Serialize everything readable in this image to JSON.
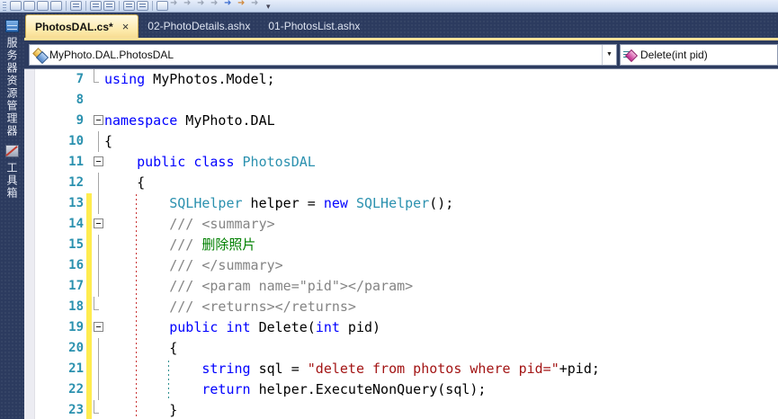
{
  "colors": {
    "tab_active": "#fde9a9",
    "chrome_navy": "#2c3b5f",
    "keyword": "#0000ff",
    "type_name": "#2b91af",
    "string_literal": "#a31515",
    "xml_doc_gray": "#848484",
    "xml_doc_green": "#008000",
    "line_number": "#2b91af",
    "change_bar_yellow": "#ffec4f"
  },
  "toolbar": {
    "icons": [
      {
        "name": "table-layout-icon",
        "kind": "box"
      },
      {
        "name": "add-item-icon",
        "kind": "box"
      },
      {
        "name": "highlight-icon",
        "kind": "box"
      },
      {
        "name": "font-color-icon",
        "kind": "box"
      },
      {
        "name": "line-list-icon",
        "kind": "lines",
        "sep_before": true
      },
      {
        "name": "indent-decrease-icon",
        "kind": "lines",
        "sep_before": true
      },
      {
        "name": "indent-increase-icon",
        "kind": "lines"
      },
      {
        "name": "align-top-icon",
        "kind": "lines",
        "sep_before": true
      },
      {
        "name": "align-bottom-icon",
        "kind": "lines"
      },
      {
        "name": "textbox-icon",
        "kind": "box",
        "sep_before": true
      },
      {
        "name": "nav-back-icon",
        "kind": "arrow"
      },
      {
        "name": "nav-forward-icon",
        "kind": "arrow"
      },
      {
        "name": "prev-position-icon",
        "kind": "arrow"
      },
      {
        "name": "next-position-icon",
        "kind": "arrow"
      },
      {
        "name": "undo-navigate-icon",
        "kind": "arrow blue"
      },
      {
        "name": "redo-navigate-icon",
        "kind": "arrow orange"
      },
      {
        "name": "find-symbol-icon",
        "kind": "arrow"
      },
      {
        "name": "toolbar-overflow-icon",
        "kind": "overflow"
      }
    ]
  },
  "tabs": [
    {
      "label": "PhotosDAL.cs*",
      "active": true,
      "close_glyph": "×"
    },
    {
      "label": "02-PhotoDetails.ashx",
      "active": false
    },
    {
      "label": "01-PhotosList.ashx",
      "active": false
    }
  ],
  "sidebar": {
    "tabs": [
      {
        "name": "server-explorer",
        "icon": "server-explorer-icon",
        "icon_class": "icon-server",
        "label": "服务器资源管理器"
      },
      {
        "name": "toolbox",
        "icon": "toolbox-icon",
        "icon_class": "icon-tools",
        "label": "工具箱"
      }
    ]
  },
  "navbar": {
    "type_dropdown": {
      "value": "MyPhoto.DAL.PhotosDAL",
      "icon": "class-icon",
      "arrow": "▼"
    },
    "member_dropdown": {
      "value": "Delete(int pid)",
      "icon": "method-icon"
    }
  },
  "code": {
    "lines": [
      {
        "n": 7,
        "fold": "tick",
        "changed": false,
        "tokens": [
          [
            "kw",
            "using"
          ],
          [
            "pl",
            " MyPhotos.Model;"
          ]
        ]
      },
      {
        "n": 8,
        "fold": "none",
        "changed": false,
        "tokens": []
      },
      {
        "n": 9,
        "fold": "minus",
        "changed": false,
        "tokens": [
          [
            "kw",
            "namespace"
          ],
          [
            "pl",
            " MyPhoto.DAL"
          ]
        ]
      },
      {
        "n": 10,
        "fold": "line",
        "changed": false,
        "tokens": [
          [
            "pl",
            "{"
          ]
        ]
      },
      {
        "n": 11,
        "fold": "minus",
        "changed": false,
        "tokens": [
          [
            "pl",
            "    "
          ],
          [
            "kw",
            "public"
          ],
          [
            "pl",
            " "
          ],
          [
            "kw",
            "class"
          ],
          [
            "pl",
            " "
          ],
          [
            "ty",
            "PhotosDAL"
          ]
        ]
      },
      {
        "n": 12,
        "fold": "line",
        "changed": false,
        "tokens": [
          [
            "pl",
            "    {"
          ]
        ]
      },
      {
        "n": 13,
        "fold": "line",
        "changed": true,
        "tokens": [
          [
            "pl",
            "        "
          ],
          [
            "ty",
            "SQLHelper"
          ],
          [
            "pl",
            " helper = "
          ],
          [
            "kw",
            "new"
          ],
          [
            "pl",
            " "
          ],
          [
            "ty",
            "SQLHelper"
          ],
          [
            "pl",
            "();"
          ]
        ]
      },
      {
        "n": 14,
        "fold": "minus",
        "changed": true,
        "tokens": [
          [
            "pl",
            "        "
          ],
          [
            "xd",
            "/// <summary>"
          ]
        ]
      },
      {
        "n": 15,
        "fold": "line",
        "changed": true,
        "tokens": [
          [
            "pl",
            "        "
          ],
          [
            "xd",
            "/// "
          ],
          [
            "xg",
            "删除照片"
          ]
        ]
      },
      {
        "n": 16,
        "fold": "line",
        "changed": true,
        "tokens": [
          [
            "pl",
            "        "
          ],
          [
            "xd",
            "/// </summary>"
          ]
        ]
      },
      {
        "n": 17,
        "fold": "line",
        "changed": true,
        "tokens": [
          [
            "pl",
            "        "
          ],
          [
            "xd",
            "/// <param name=\"pid\"></param>"
          ]
        ]
      },
      {
        "n": 18,
        "fold": "tick",
        "changed": true,
        "tokens": [
          [
            "pl",
            "        "
          ],
          [
            "xd",
            "/// <returns></returns>"
          ]
        ]
      },
      {
        "n": 19,
        "fold": "minus",
        "changed": true,
        "tokens": [
          [
            "pl",
            "        "
          ],
          [
            "kw",
            "public"
          ],
          [
            "pl",
            " "
          ],
          [
            "kw",
            "int"
          ],
          [
            "pl",
            " Delete("
          ],
          [
            "kw",
            "int"
          ],
          [
            "pl",
            " pid)"
          ]
        ]
      },
      {
        "n": 20,
        "fold": "line",
        "changed": true,
        "tokens": [
          [
            "pl",
            "        {"
          ]
        ]
      },
      {
        "n": 21,
        "fold": "line",
        "changed": true,
        "tokens": [
          [
            "pl",
            "            "
          ],
          [
            "kw",
            "string"
          ],
          [
            "pl",
            " sql = "
          ],
          [
            "st",
            "\"delete from photos where pid=\""
          ],
          [
            "pl",
            "+pid;"
          ]
        ]
      },
      {
        "n": 22,
        "fold": "line",
        "changed": true,
        "tokens": [
          [
            "pl",
            "            "
          ],
          [
            "kw",
            "return"
          ],
          [
            "pl",
            " helper.ExecuteNonQuery(sql);"
          ]
        ]
      },
      {
        "n": 23,
        "fold": "tick",
        "changed": true,
        "tokens": [
          [
            "pl",
            "        }"
          ]
        ]
      }
    ]
  }
}
